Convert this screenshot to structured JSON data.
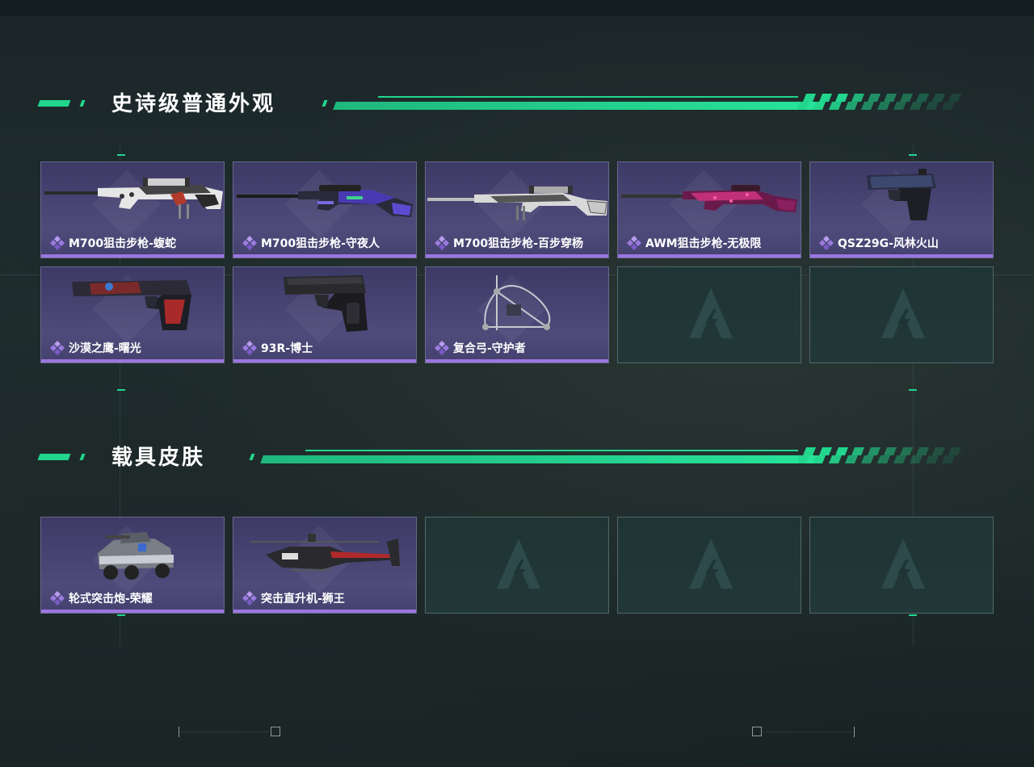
{
  "sections": [
    {
      "title": "史诗级普通外观",
      "items": [
        {
          "name": "M700狙击步枪-蝮蛇",
          "icon": "sniper-rifle"
        },
        {
          "name": "M700狙击步枪-守夜人",
          "icon": "sniper-rifle"
        },
        {
          "name": "M700狙击步枪-百步穿杨",
          "icon": "sniper-rifle"
        },
        {
          "name": "AWM狙击步枪-无极限",
          "icon": "sniper-rifle"
        },
        {
          "name": "QSZ29G-风林火山",
          "icon": "pistol"
        },
        {
          "name": "沙漠之鹰-曙光",
          "icon": "pistol"
        },
        {
          "name": "93R-博士",
          "icon": "pistol"
        },
        {
          "name": "复合弓-守护者",
          "icon": "compound-bow"
        }
      ],
      "empty_slots": 2
    },
    {
      "title": "载具皮肤",
      "items": [
        {
          "name": "轮式突击炮-荣耀",
          "icon": "armored-vehicle"
        },
        {
          "name": "突击直升机-狮王",
          "icon": "attack-helicopter"
        }
      ],
      "empty_slots": 3
    }
  ],
  "colors": {
    "accent_green": "#22d68d",
    "rarity_purple": "#9c76e0",
    "card_purple": "#45416f",
    "empty_slot": "#1f3535"
  }
}
